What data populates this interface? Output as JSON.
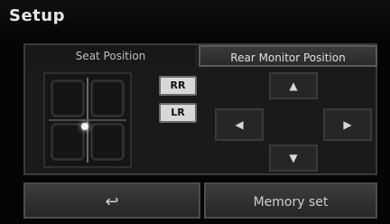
{
  "title": "Setup",
  "tabs": [
    {
      "label": "Seat Position",
      "active": false
    },
    {
      "label": "Rear Monitor Position",
      "active": true
    }
  ],
  "seat_buttons": [
    {
      "label": "RR"
    },
    {
      "label": "LR"
    }
  ],
  "direction_pad": {
    "up_icon": "triangle-up",
    "down_icon": "triangle-down",
    "left_icon": "triangle-left",
    "right_icon": "triangle-right",
    "up_glyph": "▲",
    "down_glyph": "▼",
    "left_glyph": "◀",
    "right_glyph": "▶"
  },
  "bottom_bar": {
    "back_glyph": "↩",
    "memory_label": "Memory set"
  },
  "colors": {
    "background": "#050505",
    "panel": "#1a1a1a",
    "button_active": "#d8d8d8",
    "text": "#e6e6e6"
  }
}
